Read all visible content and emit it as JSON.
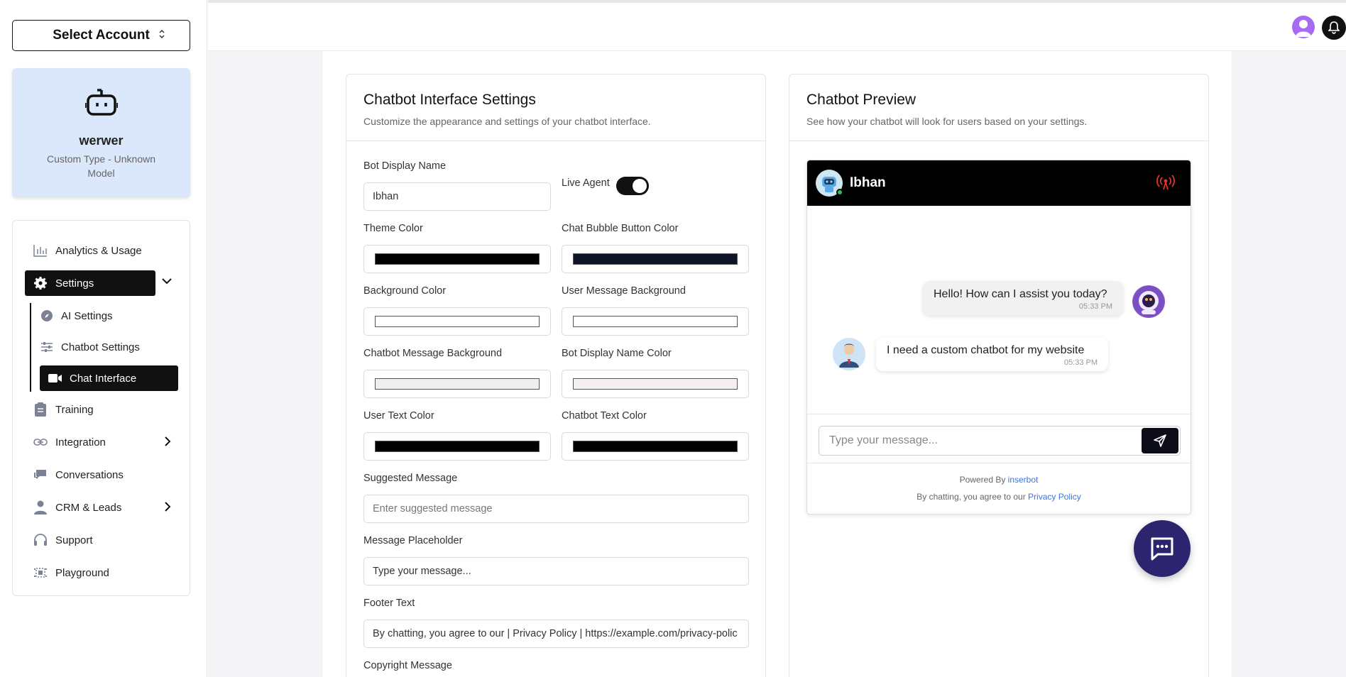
{
  "sidebar": {
    "account_select_label": "Select Account",
    "bot": {
      "name": "werwer",
      "type": "Custom Type - Unknown Model"
    },
    "nav": {
      "analytics": "Analytics & Usage",
      "settings": "Settings",
      "ai_settings": "AI Settings",
      "chatbot_settings": "Chatbot Settings",
      "chat_interface": "Chat Interface",
      "training": "Training",
      "integration": "Integration",
      "conversations": "Conversations",
      "crm": "CRM & Leads",
      "support": "Support",
      "playground": "Playground"
    }
  },
  "settings_card": {
    "title": "Chatbot Interface Settings",
    "subtitle": "Customize the appearance and settings of your chatbot interface.",
    "bot_display_name_label": "Bot Display Name",
    "bot_display_name_value": "Ibhan",
    "live_agent_label": "Live Agent",
    "live_agent_on": true,
    "theme_color_label": "Theme Color",
    "theme_color": "#000000",
    "chat_bubble_color_label": "Chat Bubble Button Color",
    "chat_bubble_color": "#0d1526",
    "background_color_label": "Background Color",
    "background_color": "#ffffff",
    "user_msg_bg_label": "User Message Background",
    "user_msg_bg": "#ffffff",
    "chatbot_msg_bg_label": "Chatbot Message Background",
    "chatbot_msg_bg": "#efefef",
    "bot_name_color_label": "Bot Display Name Color",
    "bot_name_color": "#f6efef",
    "user_text_color_label": "User Text Color",
    "user_text_color": "#000000",
    "chatbot_text_color_label": "Chatbot Text Color",
    "chatbot_text_color": "#000000",
    "suggested_message_label": "Suggested Message",
    "suggested_message_placeholder": "Enter suggested message",
    "message_placeholder_label": "Message Placeholder",
    "message_placeholder_value": "Type your message...",
    "footer_text_label": "Footer Text",
    "footer_text_value": "By chatting, you agree to our | Privacy Policy | https://example.com/privacy-polic",
    "copyright_label": "Copyright Message"
  },
  "preview_card": {
    "title": "Chatbot Preview",
    "subtitle": "See how your chatbot will look for users based on your settings.",
    "bot_name": "Ibhan",
    "messages": [
      {
        "text": "Hello! How can I assist you today?",
        "time": "05:33 PM"
      },
      {
        "text": "I need a custom chatbot for my website",
        "time": "05:33 PM"
      }
    ],
    "input_placeholder": "Type your message...",
    "powered_by_prefix": "Powered By",
    "powered_by_brand": "inserbot",
    "agree_prefix": "By chatting, you agree to our",
    "privacy_link": "Privacy Policy"
  },
  "icons": [
    "chevron-up-down-icon",
    "robot-icon",
    "bar-chart-icon",
    "gear-icon",
    "compass-icon",
    "sliders-icon",
    "video-icon",
    "clipboard-icon",
    "link-icon",
    "chat-icon",
    "user-icon",
    "headphones-icon",
    "grid-icon",
    "bell-icon",
    "broadcast-icon",
    "send-icon",
    "message-dots-icon"
  ]
}
